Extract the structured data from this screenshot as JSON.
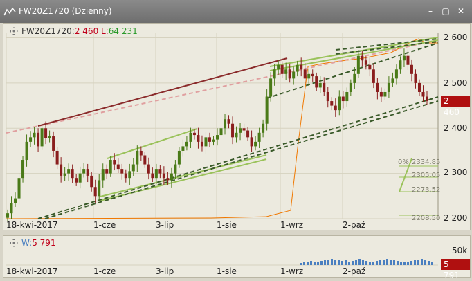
{
  "window": {
    "title": "FW20Z1720 (Dzienny)",
    "buttons": [
      "–",
      "▢",
      "✕"
    ]
  },
  "header": {
    "symbol": "FW20Z1720",
    "close_label": ":",
    "close_value": "2 460",
    "l_label": "L:",
    "l_value": "64 231"
  },
  "price_axis": {
    "ticks": [
      "2 600",
      "2 500",
      "2 400",
      "2 300",
      "2 200"
    ],
    "current_price": "2 460"
  },
  "x_axis": {
    "labels": [
      "18-kwi-2017",
      "1-cze",
      "3-lip",
      "1-sie",
      "1-wrz",
      "2-paź"
    ]
  },
  "fibonacci": {
    "labels": [
      "0%",
      "2334.85",
      "2305.05",
      "2273.52",
      "2208.50"
    ]
  },
  "volume": {
    "label": "W:",
    "value": "5 791",
    "axis_label": "50k",
    "current_value": "5 791"
  },
  "colors": {
    "up": "#4a7a18",
    "down": "#8a1e1e",
    "trend_red": "#8a2a2a",
    "trend_green": "#9ac25a",
    "dashed": "#3a5a2a",
    "pink": "#e0a0a0",
    "oi_line": "#f07800",
    "volume": "#4a7fc0"
  },
  "chart_data": {
    "type": "candlestick",
    "symbol": "FW20Z1720",
    "y_ticks": [
      2600,
      2500,
      2400,
      2300,
      2200
    ],
    "ylim": [
      2200,
      2610
    ],
    "x_tick_labels": [
      "18-kwi-2017",
      "1-cze",
      "3-lip",
      "1-sie",
      "1-wrz",
      "2-paź"
    ],
    "last_close": 2460,
    "closes": [
      2212,
      2235,
      2245,
      2290,
      2330,
      2370,
      2380,
      2390,
      2360,
      2400,
      2378,
      2382,
      2350,
      2320,
      2295,
      2300,
      2310,
      2290,
      2280,
      2300,
      2310,
      2295,
      2270,
      2250,
      2285,
      2310,
      2300,
      2330,
      2320,
      2310,
      2300,
      2290,
      2305,
      2320,
      2350,
      2340,
      2320,
      2300,
      2290,
      2310,
      2300,
      2290,
      2285,
      2300,
      2320,
      2350,
      2360,
      2370,
      2390,
      2385,
      2370,
      2360,
      2380,
      2370,
      2375,
      2385,
      2400,
      2420,
      2410,
      2380,
      2390,
      2400,
      2395,
      2380,
      2360,
      2370,
      2390,
      2410,
      2470,
      2510,
      2530,
      2540,
      2520,
      2530,
      2510,
      2525,
      2540,
      2530,
      2510,
      2520,
      2515,
      2490,
      2500,
      2480,
      2460,
      2450,
      2440,
      2470,
      2460,
      2480,
      2500,
      2520,
      2560,
      2550,
      2540,
      2530,
      2500,
      2480,
      2470,
      2480,
      2500,
      2510,
      2530,
      2550,
      2560,
      2540,
      2520,
      2500,
      2480,
      2470,
      2460
    ],
    "volume_axis": "50k",
    "last_volume": 5791
  }
}
